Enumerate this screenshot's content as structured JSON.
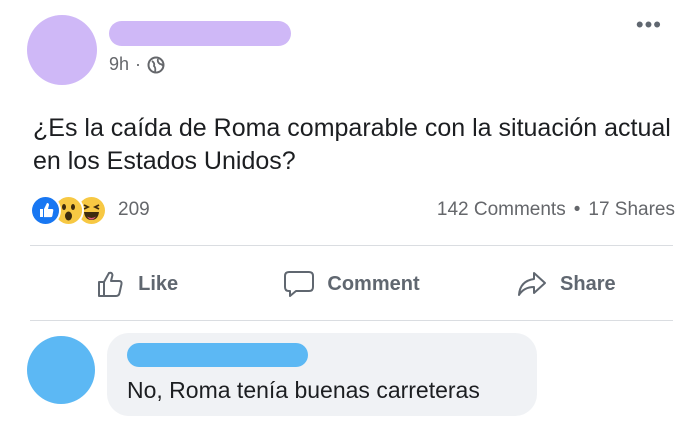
{
  "post": {
    "time": "9h",
    "dot": "·",
    "text": "¿Es la caída de Roma comparable con la situación actual en los Estados Unidos?",
    "more_glyph": "•••"
  },
  "stats": {
    "reactions_count": "209",
    "reaction_icons": [
      "like-icon",
      "wow-icon",
      "haha-icon"
    ],
    "comments": "142 Comments",
    "separator": "•",
    "shares": "17 Shares"
  },
  "actions": {
    "like": "Like",
    "comment": "Comment",
    "share": "Share"
  },
  "comment": {
    "text": "No, Roma tenía buenas carreteras"
  },
  "colors": {
    "post_avatar": "#cfb8f7",
    "comment_avatar": "#5cb8f4",
    "like_blue": "#1877f2",
    "emoji_yellow": "#f7c843",
    "muted_text": "#65676b"
  }
}
